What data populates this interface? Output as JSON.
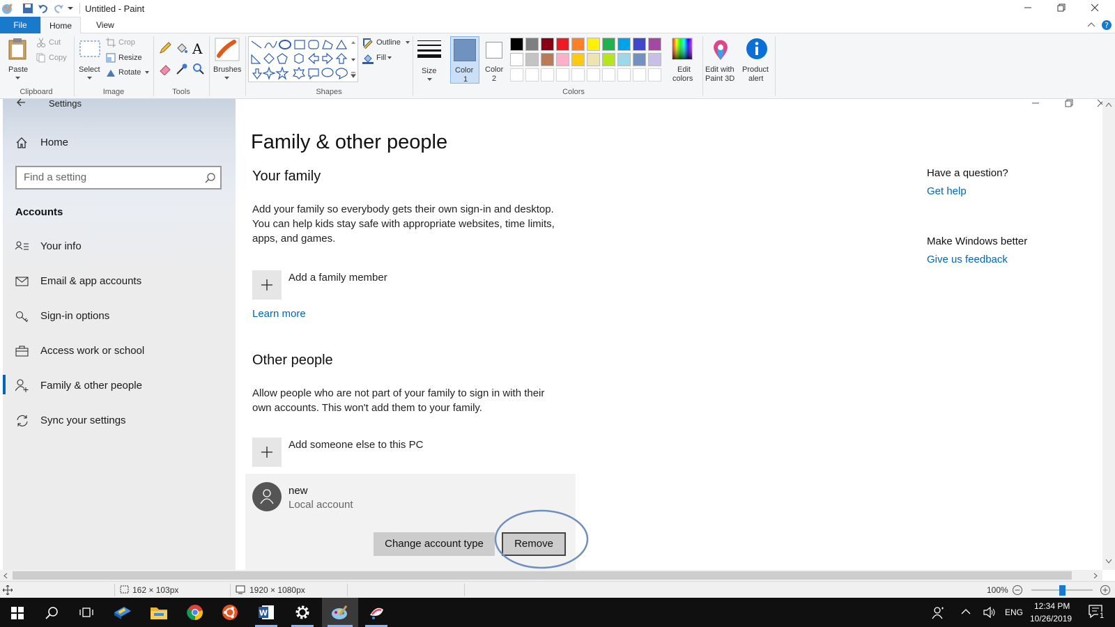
{
  "app": {
    "title": "Untitled - Paint"
  },
  "tabs": {
    "file": "File",
    "home": "Home",
    "view": "View"
  },
  "ribbon": {
    "clipboard": {
      "label": "Clipboard",
      "paste": "Paste",
      "cut": "Cut",
      "copy": "Copy"
    },
    "image": {
      "label": "Image",
      "select": "Select",
      "crop": "Crop",
      "resize": "Resize",
      "rotate": "Rotate"
    },
    "tools": {
      "label": "Tools"
    },
    "brushes": "Brushes",
    "shapes": {
      "label": "Shapes",
      "outline": "Outline",
      "fill": "Fill"
    },
    "size": "Size",
    "color1": {
      "line1": "Color",
      "line2": "1"
    },
    "color2": {
      "line1": "Color",
      "line2": "2"
    },
    "colors": {
      "label": "Colors",
      "row1": [
        "#000000",
        "#7f7f7f",
        "#880015",
        "#ed1c24",
        "#ff7f27",
        "#fff200",
        "#22b14c",
        "#00a2e8",
        "#3f48cc",
        "#a349a4"
      ],
      "row2": [
        "#ffffff",
        "#c3c3c3",
        "#b97a57",
        "#ffaec9",
        "#ffc90e",
        "#efe4b0",
        "#b5e61d",
        "#99d9ea",
        "#7092be",
        "#c8bfe7"
      ]
    },
    "edit_colors": {
      "line1": "Edit",
      "line2": "colors"
    },
    "paint3d": {
      "line1": "Edit with",
      "line2": "Paint 3D"
    },
    "alert": {
      "line1": "Product",
      "line2": "alert"
    }
  },
  "settings": {
    "title": "Settings",
    "home": "Home",
    "search_placeholder": "Find a setting",
    "section": "Accounts",
    "nav": [
      "Your info",
      "Email & app accounts",
      "Sign-in options",
      "Access work or school",
      "Family & other people",
      "Sync your settings"
    ],
    "page_title": "Family & other people",
    "your_family": {
      "heading": "Your family",
      "text_lines": [
        "Add your family so everybody gets their own sign-in and desktop.",
        "You can help kids stay safe with appropriate websites, time limits,",
        "apps, and games."
      ],
      "add": "Add a family member",
      "learn": "Learn more"
    },
    "other_people": {
      "heading": "Other people",
      "text_lines": [
        "Allow people who are not part of your family to sign in with their",
        "own accounts. This won't add them to your family."
      ],
      "add": "Add someone else to this PC",
      "account_name": "new",
      "account_type": "Local account",
      "change_btn": "Change account type",
      "remove_btn": "Remove"
    },
    "side": {
      "question": "Have a question?",
      "help": "Get help",
      "better": "Make Windows better",
      "feedback": "Give us feedback"
    }
  },
  "status": {
    "selection": "162 × 103px",
    "canvas": "1920 × 1080px",
    "zoom": "100%"
  },
  "tray": {
    "lang": "ENG",
    "time": "12:34 PM",
    "date": "10/26/2019",
    "notifications": "1"
  }
}
